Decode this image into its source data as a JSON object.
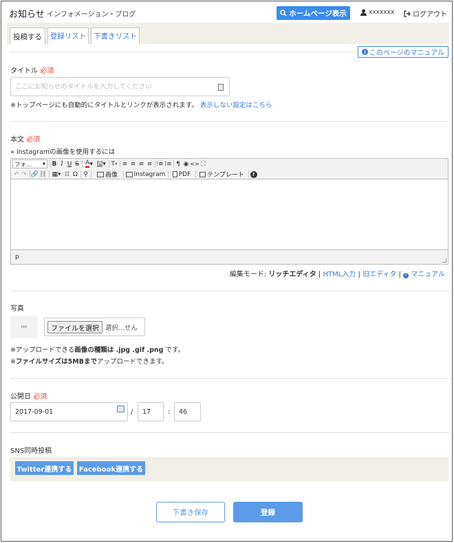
{
  "header": {
    "title": "お知らせ",
    "subtitle": "インフォメーション・ブログ",
    "homepage_button": "ホームページ表示",
    "username": "xxxxxxx",
    "logout": "ログアウト"
  },
  "tabs": [
    {
      "label": "投稿する"
    },
    {
      "label": "登録リスト"
    },
    {
      "label": "下書きリスト"
    }
  ],
  "manual_button": "このページのマニュアル",
  "title_field": {
    "label": "タイトル",
    "required": "必須",
    "placeholder": "ここにお知らせのタイトルを入力してください",
    "value": "",
    "note": "※トップページにも自動的にタイトルとリンクが表示されます。",
    "note_link": "表示しない設定はこちら"
  },
  "body_field": {
    "label": "本文",
    "required": "必須",
    "instagram_link": "» Instagramの画像を使用するには",
    "format_combo": "フォ...",
    "toolbar_image": "画像",
    "toolbar_instagram": "Instagram",
    "toolbar_pdf": "PDF",
    "toolbar_template": "テンプレート",
    "status_path": "p"
  },
  "edit_mode": {
    "label": "編集モード:",
    "rich": "リッチエディタ",
    "html": "HTML入力",
    "old": "旧エディタ",
    "manual": "マニュアル",
    "separator": "|"
  },
  "photo": {
    "label": "写真",
    "thumb_text": "ııııı",
    "file_button": "ファイルを選択",
    "file_text": "選択...せん",
    "note1_prefix": "※アップロードできる",
    "note1_bold": "画像の種類は .jpg .gif .png",
    "note1_suffix": " です。",
    "note2_prefix": "※",
    "note2_bold": "ファイルサイズは5MBまで",
    "note2_suffix": "アップロードできます。"
  },
  "publish_date": {
    "label": "公開日",
    "required": "必須",
    "date": "2017-09-01",
    "sep1": "/",
    "hour": "17",
    "sep2": ":",
    "minute": "46"
  },
  "sns": {
    "label": "SNS同時投稿",
    "twitter": "Twitter連携する",
    "facebook": "Facebook連携する"
  },
  "actions": {
    "draft": "下書き保存",
    "submit": "登録"
  },
  "colors": {
    "accent": "#3a8cf0",
    "button": "#5b9be8",
    "required": "#e04a3a",
    "panel": "#f1efe7"
  }
}
